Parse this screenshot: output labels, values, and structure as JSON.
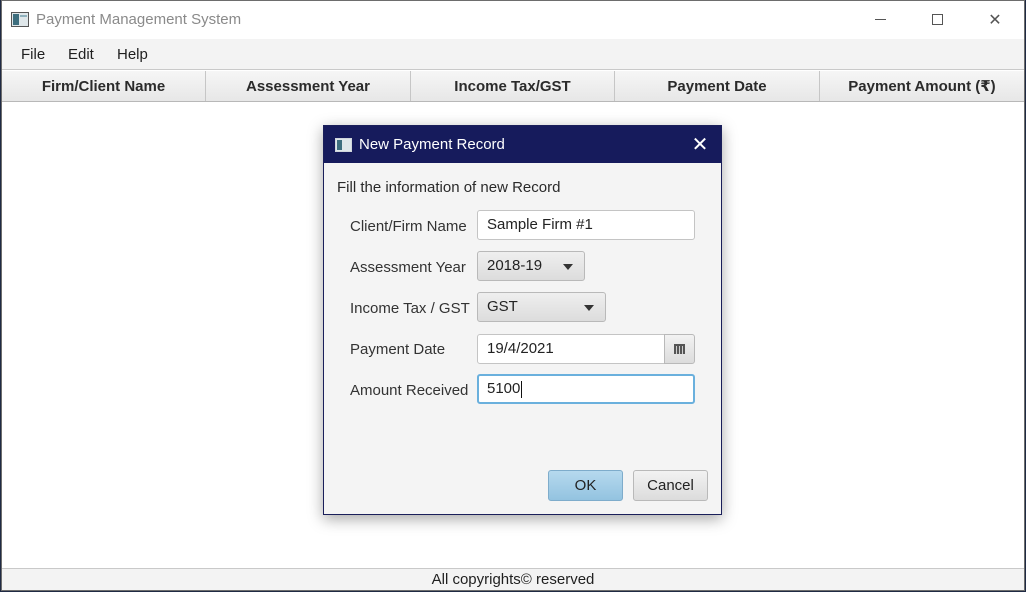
{
  "window": {
    "title": "Payment Management System",
    "controls": {
      "minimize": "minimize",
      "maximize": "maximize",
      "close": "✕"
    }
  },
  "menu": [
    "File",
    "Edit",
    "Help"
  ],
  "table": {
    "columns": [
      "Firm/Client Name",
      "Assessment Year",
      "Income Tax/GST",
      "Payment Date",
      "Payment Amount (₹)"
    ],
    "rows": []
  },
  "footer": {
    "text": "All copyrights© reserved"
  },
  "dialog": {
    "title": "New Payment Record",
    "close": "✕",
    "header": "Fill the information of new Record",
    "fields": {
      "client_name": {
        "label": "Client/Firm Name",
        "value": "Sample Firm #1"
      },
      "assessment_year": {
        "label": "Assessment Year",
        "value": "2018-19"
      },
      "tax_type": {
        "label": "Income Tax / GST",
        "value": "GST"
      },
      "payment_date": {
        "label": "Payment Date",
        "value": "19/4/2021"
      },
      "amount": {
        "label": "Amount Received",
        "value": "5100"
      }
    },
    "buttons": {
      "ok": "OK",
      "cancel": "Cancel"
    }
  },
  "colors": {
    "dialog_title_bg": "#161b5c",
    "ok_button": "#a8d0e8",
    "focus_ring": "#6ab0dd"
  },
  "icons": [
    "app-icon",
    "calendar-icon",
    "close-icon",
    "chevron-down-icon"
  ]
}
